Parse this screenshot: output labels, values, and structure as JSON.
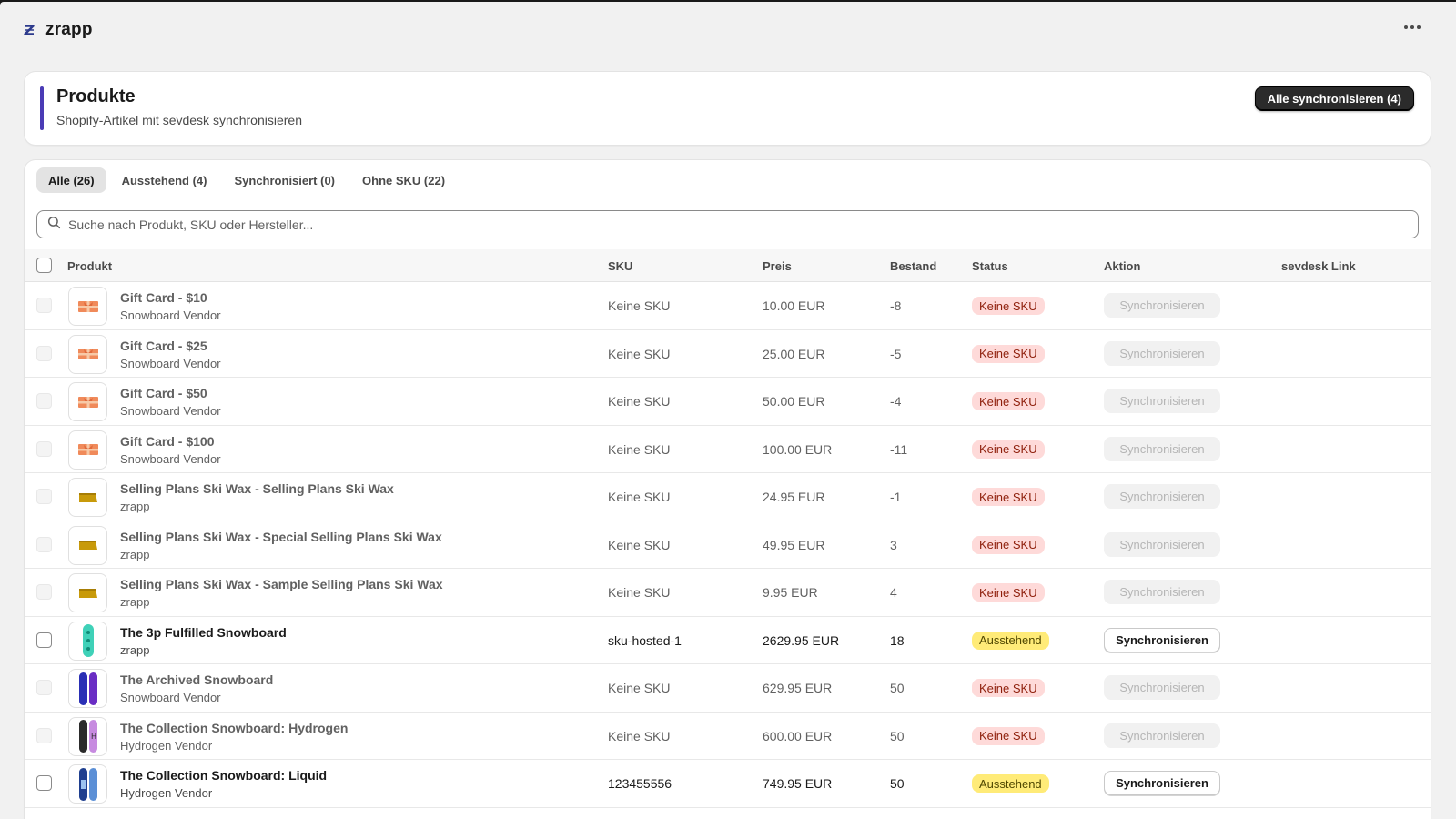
{
  "app": {
    "name": "zrapp"
  },
  "header": {
    "title": "Produkte",
    "subtitle": "Shopify-Artikel mit sevdesk synchronisieren",
    "sync_all_label": "Alle synchronisieren (4)"
  },
  "tabs": [
    {
      "label": "Alle (26)",
      "active": true
    },
    {
      "label": "Ausstehend (4)",
      "active": false
    },
    {
      "label": "Synchronisiert (0)",
      "active": false
    },
    {
      "label": "Ohne SKU (22)",
      "active": false
    }
  ],
  "search": {
    "placeholder": "Suche nach Produkt, SKU oder Hersteller..."
  },
  "table": {
    "headers": {
      "product": "Produkt",
      "sku": "SKU",
      "price": "Preis",
      "stock": "Bestand",
      "status": "Status",
      "action": "Aktion",
      "link": "sevdesk Link"
    },
    "rows": [
      {
        "name": "Gift Card - $10",
        "vendor": "Snowboard Vendor",
        "sku": "Keine SKU",
        "price": "10.00 EUR",
        "stock": "-8",
        "status": "Keine SKU",
        "status_type": "nosku",
        "action": "Synchronisieren",
        "enabled": false,
        "thumb": "gift-card-icon"
      },
      {
        "name": "Gift Card - $25",
        "vendor": "Snowboard Vendor",
        "sku": "Keine SKU",
        "price": "25.00 EUR",
        "stock": "-5",
        "status": "Keine SKU",
        "status_type": "nosku",
        "action": "Synchronisieren",
        "enabled": false,
        "thumb": "gift-card-icon"
      },
      {
        "name": "Gift Card - $50",
        "vendor": "Snowboard Vendor",
        "sku": "Keine SKU",
        "price": "50.00 EUR",
        "stock": "-4",
        "status": "Keine SKU",
        "status_type": "nosku",
        "action": "Synchronisieren",
        "enabled": false,
        "thumb": "gift-card-icon"
      },
      {
        "name": "Gift Card - $100",
        "vendor": "Snowboard Vendor",
        "sku": "Keine SKU",
        "price": "100.00 EUR",
        "stock": "-11",
        "status": "Keine SKU",
        "status_type": "nosku",
        "action": "Synchronisieren",
        "enabled": false,
        "thumb": "gift-card-icon"
      },
      {
        "name": "Selling Plans Ski Wax - Selling Plans Ski Wax",
        "vendor": "zrapp",
        "sku": "Keine SKU",
        "price": "24.95 EUR",
        "stock": "-1",
        "status": "Keine SKU",
        "status_type": "nosku",
        "action": "Synchronisieren",
        "enabled": false,
        "thumb": "ski-wax-icon"
      },
      {
        "name": "Selling Plans Ski Wax - Special Selling Plans Ski Wax",
        "vendor": "zrapp",
        "sku": "Keine SKU",
        "price": "49.95 EUR",
        "stock": "3",
        "status": "Keine SKU",
        "status_type": "nosku",
        "action": "Synchronisieren",
        "enabled": false,
        "thumb": "ski-wax-icon"
      },
      {
        "name": "Selling Plans Ski Wax - Sample Selling Plans Ski Wax",
        "vendor": "zrapp",
        "sku": "Keine SKU",
        "price": "9.95 EUR",
        "stock": "4",
        "status": "Keine SKU",
        "status_type": "nosku",
        "action": "Synchronisieren",
        "enabled": false,
        "thumb": "ski-wax-icon"
      },
      {
        "name": "The 3p Fulfilled Snowboard",
        "vendor": "zrapp",
        "sku": "sku-hosted-1",
        "price": "2629.95 EUR",
        "stock": "18",
        "status": "Ausstehend",
        "status_type": "pending",
        "action": "Synchronisieren",
        "enabled": true,
        "thumb": "snowboard-teal-icon"
      },
      {
        "name": "The Archived Snowboard",
        "vendor": "Snowboard Vendor",
        "sku": "Keine SKU",
        "price": "629.95 EUR",
        "stock": "50",
        "status": "Keine SKU",
        "status_type": "nosku",
        "action": "Synchronisieren",
        "enabled": false,
        "thumb": "snowboard-purple-icon"
      },
      {
        "name": "The Collection Snowboard: Hydrogen",
        "vendor": "Hydrogen Vendor",
        "sku": "Keine SKU",
        "price": "600.00 EUR",
        "stock": "50",
        "status": "Keine SKU",
        "status_type": "nosku",
        "action": "Synchronisieren",
        "enabled": false,
        "thumb": "snowboard-hydrogen-icon"
      },
      {
        "name": "The Collection Snowboard: Liquid",
        "vendor": "Hydrogen Vendor",
        "sku": "123455556",
        "price": "749.95 EUR",
        "stock": "50",
        "status": "Ausstehend",
        "status_type": "pending",
        "action": "Synchronisieren",
        "enabled": true,
        "thumb": "snowboard-liquid-icon"
      }
    ]
  },
  "colors": {
    "accent": "#4a3bb5",
    "badge_nosku_bg": "#fedad9",
    "badge_pending_bg": "#ffeb78",
    "primary_button": "#2b2b2b"
  }
}
